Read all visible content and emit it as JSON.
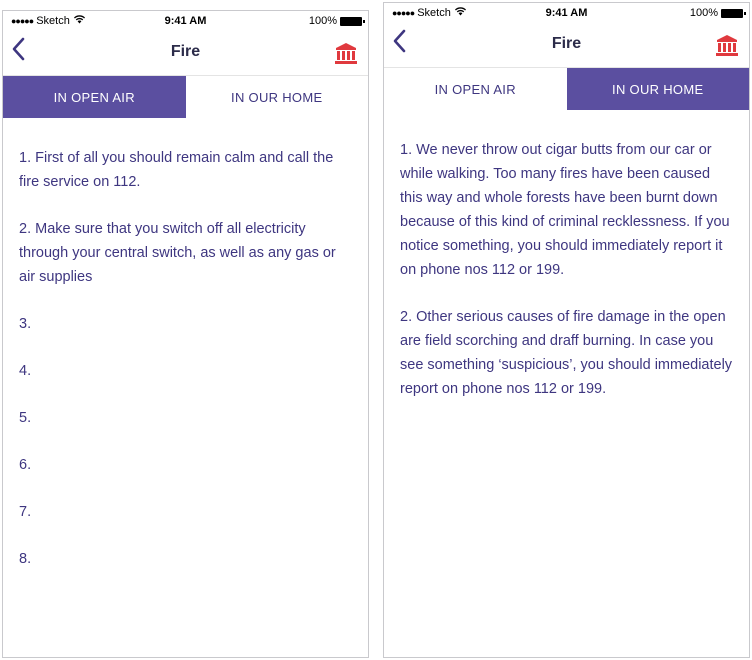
{
  "status_bar": {
    "carrier": "Sketch",
    "time": "9:41 AM",
    "battery": "100%"
  },
  "left_screen": {
    "title": "Fire",
    "tabs": [
      {
        "label": "IN OPEN AIR",
        "active": true
      },
      {
        "label": "IN OUR HOME",
        "active": false
      }
    ],
    "items": [
      "1. First of all you should remain calm and call the fire service on 112.",
      "2. Make sure that you switch off all electricity through your central switch, as well as any gas or air supplies",
      "3.",
      "4.",
      "5.",
      "6.",
      "7.",
      "8."
    ]
  },
  "right_screen": {
    "title": "Fire",
    "tabs": [
      {
        "label": "IN OPEN AIR",
        "active": false
      },
      {
        "label": "IN OUR HOME",
        "active": true
      }
    ],
    "items": [
      "1. We never throw out cigar butts from our car or while walking. Too many fires have been caused this way and whole forests have been burnt down because of this kind of criminal recklessness. If you notice something, you should immediately report it on phone nos 112 or 199.",
      "2. Other serious causes of fire damage in the open are field scorching and draff burning. In case you see something ‘suspicious’, you should immediately report on phone nos 112 or 199."
    ]
  },
  "icons": {
    "back": "chevron-left-icon",
    "nav_action": "building-icon",
    "wifi": "wifi-icon",
    "battery": "battery-icon"
  },
  "colors": {
    "accent": "#5b4fa0",
    "text": "#3e3680",
    "icon_red": "#e0393e"
  }
}
